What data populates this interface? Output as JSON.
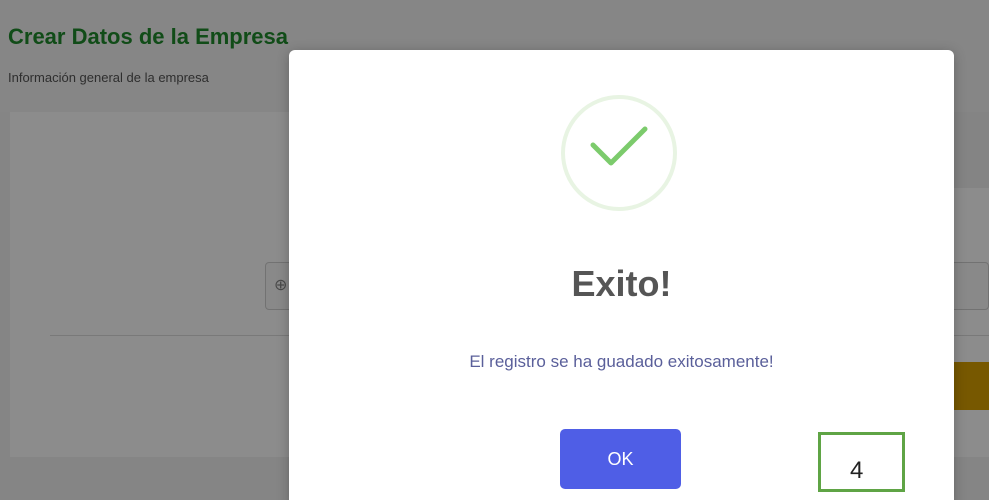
{
  "page": {
    "title": "Crear Datos de la Empresa",
    "subtitle": "Información general de la empresa"
  },
  "modal": {
    "icon": "check-icon",
    "title": "Exito!",
    "message": "El registro se ha guadado exitosamente!",
    "ok_label": "OK"
  },
  "annotation": {
    "label": "4"
  },
  "colors": {
    "title_green": "#1f8a2c",
    "success_green": "#7ccb6c",
    "ok_button": "#4f5ee6",
    "message_text": "#5a5f9a",
    "annotation_border": "#5fa445",
    "background_warning": "#d9a000"
  }
}
